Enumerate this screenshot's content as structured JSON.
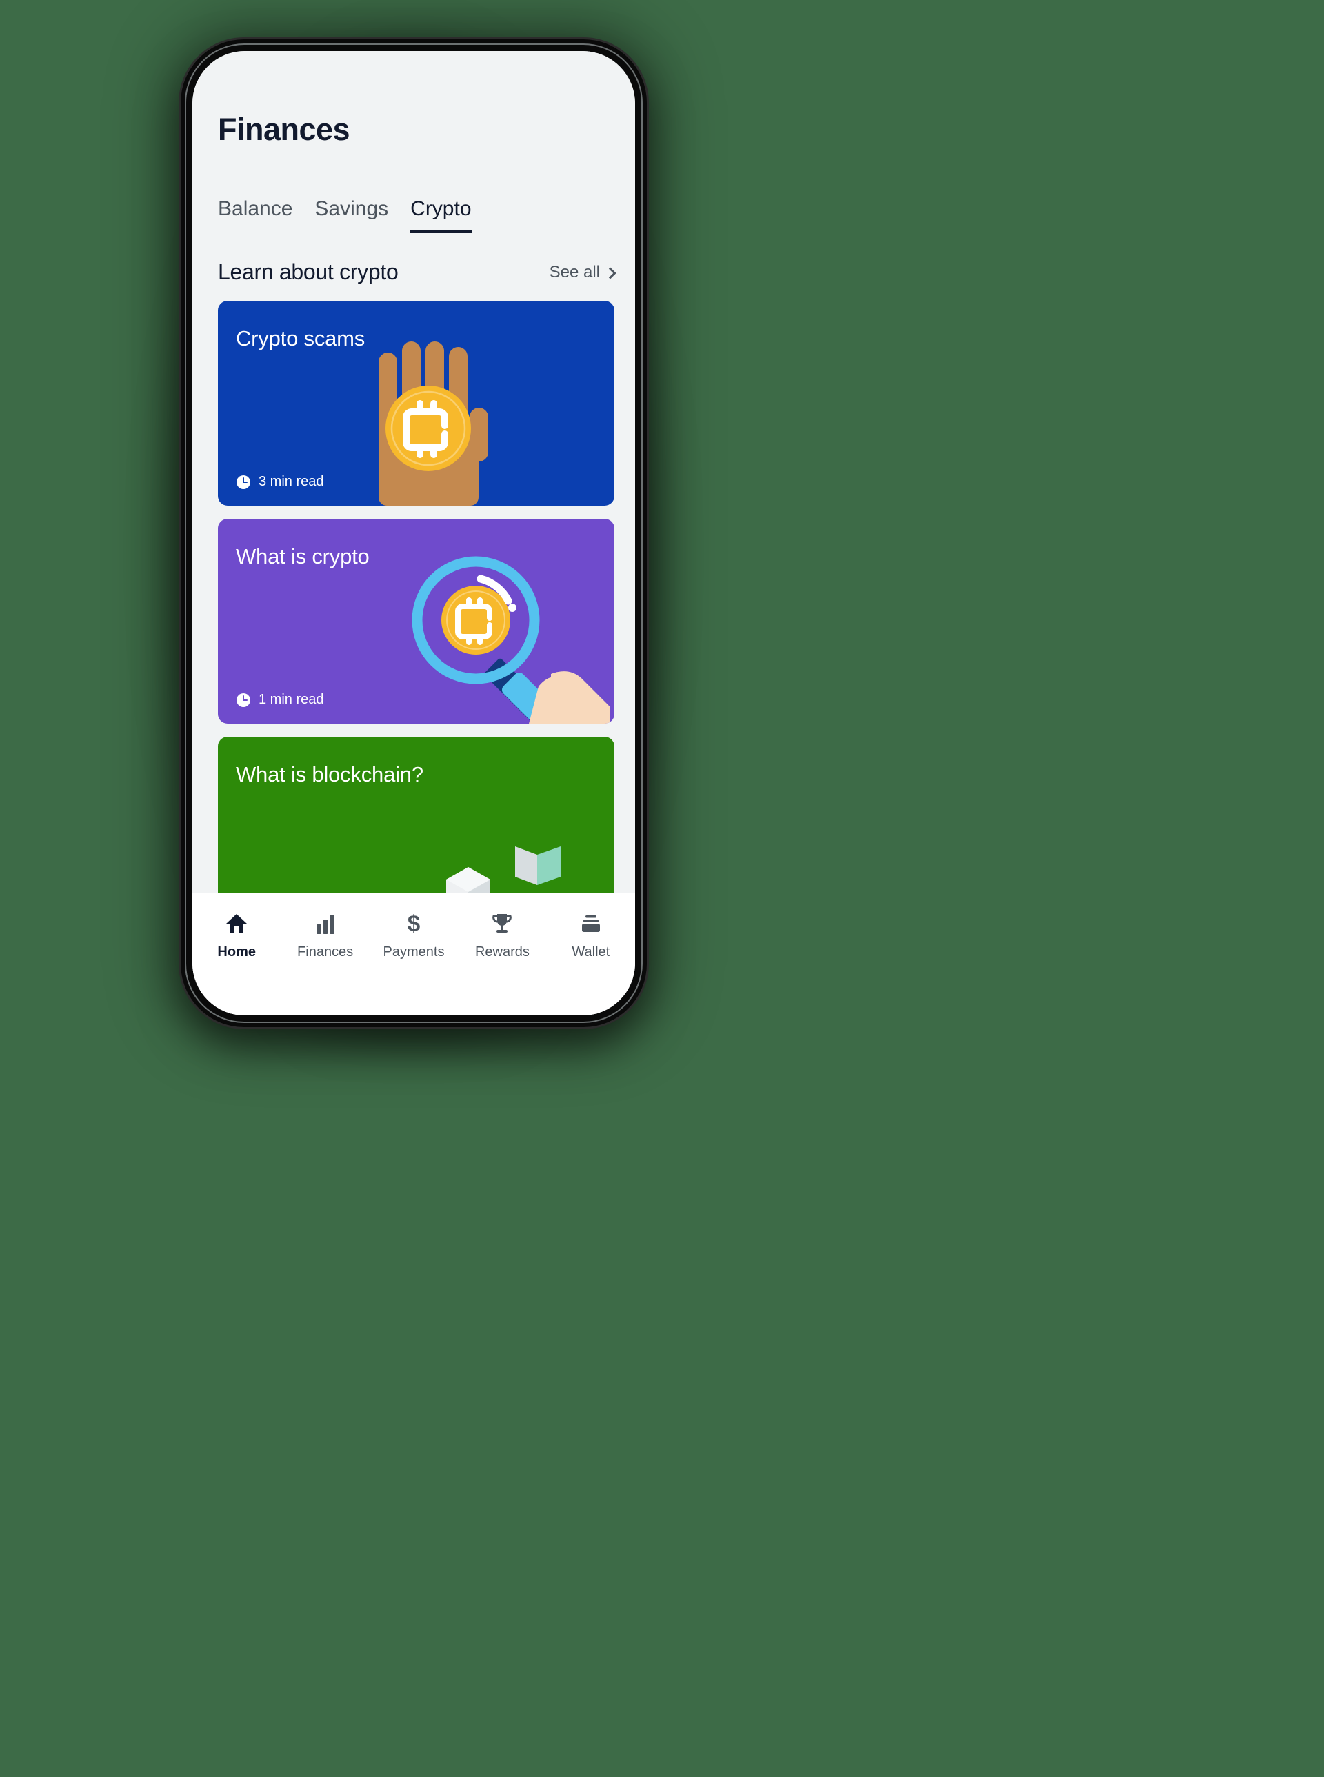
{
  "app": {
    "page_title": "Finances"
  },
  "tabs": [
    {
      "label": "Balance",
      "active": false
    },
    {
      "label": "Savings",
      "active": false
    },
    {
      "label": "Crypto",
      "active": true
    }
  ],
  "section": {
    "title": "Learn about crypto",
    "see_all_label": "See all",
    "see_all_icon": "chevron-right-icon"
  },
  "cards": [
    {
      "title": "Crypto scams",
      "read_time": "3 min read",
      "read_icon": "clock-icon",
      "bg_color": "#0b3fb0",
      "art": "hand-holding-coin"
    },
    {
      "title": "What is crypto",
      "read_time": "1 min read",
      "read_icon": "clock-icon",
      "bg_color": "#6f4bcc",
      "art": "magnifier-over-coin"
    },
    {
      "title": "What is blockchain?",
      "read_time": "",
      "read_icon": "",
      "bg_color": "#2d8a09",
      "art": "blockchain-nodes"
    }
  ],
  "bottom_nav": [
    {
      "label": "Home",
      "icon": "home-icon",
      "active": true
    },
    {
      "label": "Finances",
      "icon": "bar-chart-icon",
      "active": false
    },
    {
      "label": "Payments",
      "icon": "dollar-icon",
      "active": false
    },
    {
      "label": "Rewards",
      "icon": "trophy-icon",
      "active": false
    },
    {
      "label": "Wallet",
      "icon": "wallet-icon",
      "active": false
    }
  ],
  "colors": {
    "background": "#3d6b47",
    "screen_bg": "#f1f3f4",
    "text_dark": "#121a2e",
    "text_muted": "#4d555e",
    "coin_gold": "#f7b92c",
    "skin_tan": "#c4894f",
    "skin_light": "#f8d9bc",
    "magnifier_blue": "#55c2ef",
    "handle_navy": "#123a80",
    "node_mint": "#8ed6bf",
    "node_white": "#eef0f2"
  }
}
